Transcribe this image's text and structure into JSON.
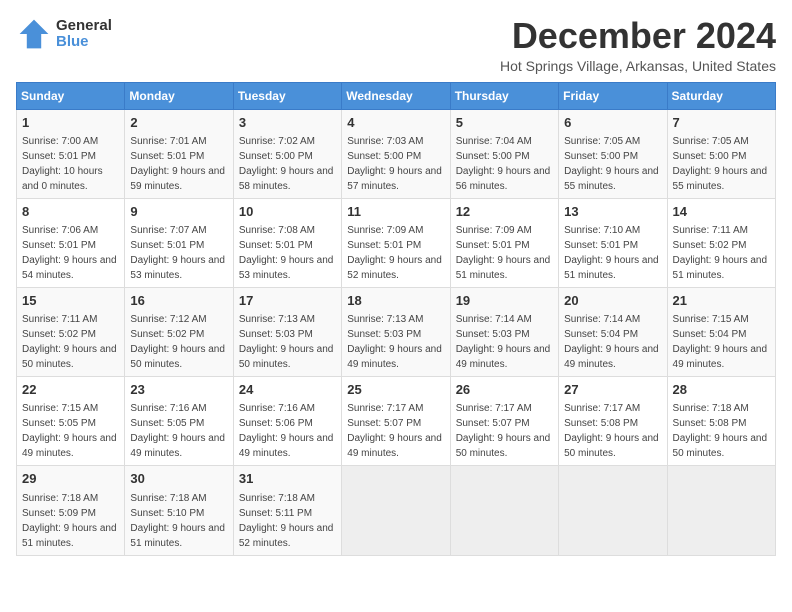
{
  "logo": {
    "general": "General",
    "blue": "Blue"
  },
  "title": "December 2024",
  "location": "Hot Springs Village, Arkansas, United States",
  "weekdays": [
    "Sunday",
    "Monday",
    "Tuesday",
    "Wednesday",
    "Thursday",
    "Friday",
    "Saturday"
  ],
  "weeks": [
    [
      {
        "day": "1",
        "sunrise": "7:00 AM",
        "sunset": "5:01 PM",
        "daylight": "10 hours and 0 minutes."
      },
      {
        "day": "2",
        "sunrise": "7:01 AM",
        "sunset": "5:01 PM",
        "daylight": "9 hours and 59 minutes."
      },
      {
        "day": "3",
        "sunrise": "7:02 AM",
        "sunset": "5:00 PM",
        "daylight": "9 hours and 58 minutes."
      },
      {
        "day": "4",
        "sunrise": "7:03 AM",
        "sunset": "5:00 PM",
        "daylight": "9 hours and 57 minutes."
      },
      {
        "day": "5",
        "sunrise": "7:04 AM",
        "sunset": "5:00 PM",
        "daylight": "9 hours and 56 minutes."
      },
      {
        "day": "6",
        "sunrise": "7:05 AM",
        "sunset": "5:00 PM",
        "daylight": "9 hours and 55 minutes."
      },
      {
        "day": "7",
        "sunrise": "7:05 AM",
        "sunset": "5:00 PM",
        "daylight": "9 hours and 55 minutes."
      }
    ],
    [
      {
        "day": "8",
        "sunrise": "7:06 AM",
        "sunset": "5:01 PM",
        "daylight": "9 hours and 54 minutes."
      },
      {
        "day": "9",
        "sunrise": "7:07 AM",
        "sunset": "5:01 PM",
        "daylight": "9 hours and 53 minutes."
      },
      {
        "day": "10",
        "sunrise": "7:08 AM",
        "sunset": "5:01 PM",
        "daylight": "9 hours and 53 minutes."
      },
      {
        "day": "11",
        "sunrise": "7:09 AM",
        "sunset": "5:01 PM",
        "daylight": "9 hours and 52 minutes."
      },
      {
        "day": "12",
        "sunrise": "7:09 AM",
        "sunset": "5:01 PM",
        "daylight": "9 hours and 51 minutes."
      },
      {
        "day": "13",
        "sunrise": "7:10 AM",
        "sunset": "5:01 PM",
        "daylight": "9 hours and 51 minutes."
      },
      {
        "day": "14",
        "sunrise": "7:11 AM",
        "sunset": "5:02 PM",
        "daylight": "9 hours and 51 minutes."
      }
    ],
    [
      {
        "day": "15",
        "sunrise": "7:11 AM",
        "sunset": "5:02 PM",
        "daylight": "9 hours and 50 minutes."
      },
      {
        "day": "16",
        "sunrise": "7:12 AM",
        "sunset": "5:02 PM",
        "daylight": "9 hours and 50 minutes."
      },
      {
        "day": "17",
        "sunrise": "7:13 AM",
        "sunset": "5:03 PM",
        "daylight": "9 hours and 50 minutes."
      },
      {
        "day": "18",
        "sunrise": "7:13 AM",
        "sunset": "5:03 PM",
        "daylight": "9 hours and 49 minutes."
      },
      {
        "day": "19",
        "sunrise": "7:14 AM",
        "sunset": "5:03 PM",
        "daylight": "9 hours and 49 minutes."
      },
      {
        "day": "20",
        "sunrise": "7:14 AM",
        "sunset": "5:04 PM",
        "daylight": "9 hours and 49 minutes."
      },
      {
        "day": "21",
        "sunrise": "7:15 AM",
        "sunset": "5:04 PM",
        "daylight": "9 hours and 49 minutes."
      }
    ],
    [
      {
        "day": "22",
        "sunrise": "7:15 AM",
        "sunset": "5:05 PM",
        "daylight": "9 hours and 49 minutes."
      },
      {
        "day": "23",
        "sunrise": "7:16 AM",
        "sunset": "5:05 PM",
        "daylight": "9 hours and 49 minutes."
      },
      {
        "day": "24",
        "sunrise": "7:16 AM",
        "sunset": "5:06 PM",
        "daylight": "9 hours and 49 minutes."
      },
      {
        "day": "25",
        "sunrise": "7:17 AM",
        "sunset": "5:07 PM",
        "daylight": "9 hours and 49 minutes."
      },
      {
        "day": "26",
        "sunrise": "7:17 AM",
        "sunset": "5:07 PM",
        "daylight": "9 hours and 50 minutes."
      },
      {
        "day": "27",
        "sunrise": "7:17 AM",
        "sunset": "5:08 PM",
        "daylight": "9 hours and 50 minutes."
      },
      {
        "day": "28",
        "sunrise": "7:18 AM",
        "sunset": "5:08 PM",
        "daylight": "9 hours and 50 minutes."
      }
    ],
    [
      {
        "day": "29",
        "sunrise": "7:18 AM",
        "sunset": "5:09 PM",
        "daylight": "9 hours and 51 minutes."
      },
      {
        "day": "30",
        "sunrise": "7:18 AM",
        "sunset": "5:10 PM",
        "daylight": "9 hours and 51 minutes."
      },
      {
        "day": "31",
        "sunrise": "7:18 AM",
        "sunset": "5:11 PM",
        "daylight": "9 hours and 52 minutes."
      },
      null,
      null,
      null,
      null
    ]
  ],
  "labels": {
    "sunrise": "Sunrise:",
    "sunset": "Sunset:",
    "daylight": "Daylight:"
  }
}
